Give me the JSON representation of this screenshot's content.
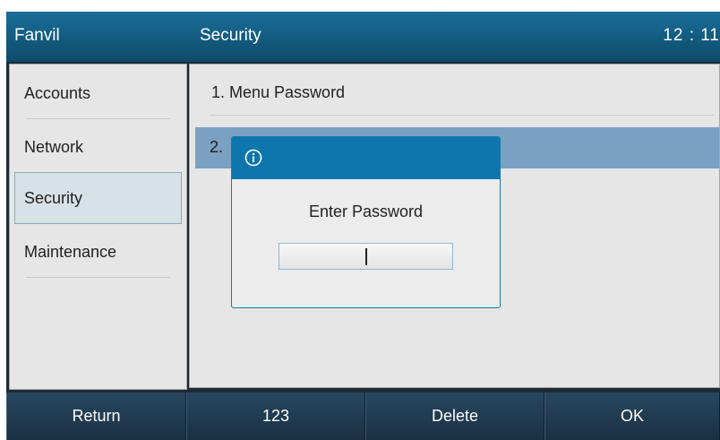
{
  "topbar": {
    "brand": "Fanvil",
    "title": "Security",
    "time": "12 : 11"
  },
  "sidebar": {
    "items": [
      {
        "label": "Accounts"
      },
      {
        "label": "Network"
      },
      {
        "label": "Security"
      },
      {
        "label": "Maintenance"
      }
    ],
    "active_index": 2
  },
  "main": {
    "items": [
      {
        "label": "1. Menu Password"
      },
      {
        "label": "2."
      }
    ],
    "selected_index": 1
  },
  "dialog": {
    "icon": "info-icon",
    "title": "Enter Password",
    "password_value": ""
  },
  "softkeys": [
    {
      "label": "Return"
    },
    {
      "label": "123"
    },
    {
      "label": "Delete"
    },
    {
      "label": "OK"
    }
  ],
  "colors": {
    "header_blue": "#125a7f",
    "dialog_header": "#0f76ad",
    "selected_row": "#7aa1c2",
    "softkey_bg": "#1a3043"
  }
}
